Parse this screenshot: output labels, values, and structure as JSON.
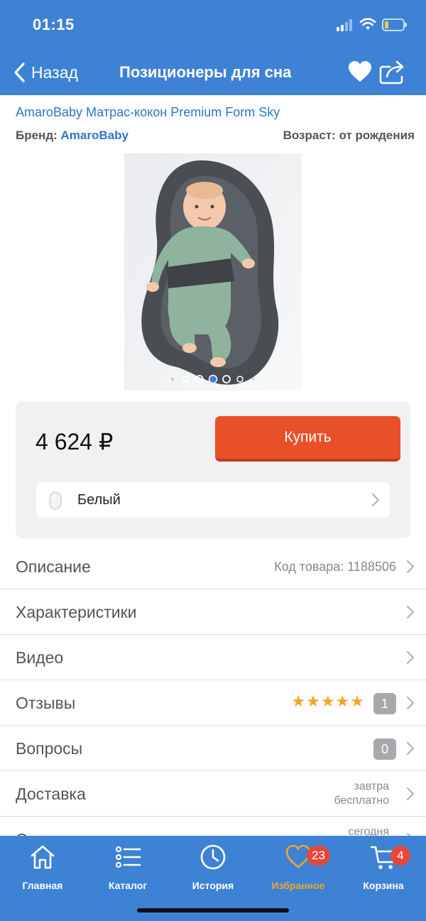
{
  "status_bar": {
    "time": "01:15"
  },
  "header": {
    "back_label": "Назад",
    "title": "Позиционеры для сна"
  },
  "product": {
    "name": "AmaroBaby Матрас-кокон Premium Form Sky",
    "brand_label": "Бренд:",
    "brand_value": "AmaroBaby",
    "age_label": "Возраст:",
    "age_value": "от рождения",
    "gallery": {
      "pages": 7,
      "active_page": 4
    }
  },
  "purchase": {
    "price": "4 624 ₽",
    "buy_label": "Купить",
    "color_label": "Белый"
  },
  "info_rows": {
    "description": {
      "label": "Описание",
      "right": "Код товара: 1188506"
    },
    "specs": {
      "label": "Характеристики"
    },
    "video": {
      "label": "Видео"
    },
    "reviews": {
      "label": "Отзывы",
      "stars": "★★★★★",
      "count": "1"
    },
    "questions": {
      "label": "Вопросы",
      "count": "0"
    },
    "delivery": {
      "label": "Доставка",
      "line1": "завтра",
      "line2": "бесплатно"
    },
    "pickup": {
      "label": "Самовывоз",
      "line1": "сегодня"
    }
  },
  "tabbar": {
    "home": "Главная",
    "catalog": "Каталог",
    "history": "История",
    "favorites": "Избранное",
    "favorites_badge": "23",
    "cart": "Корзина",
    "cart_badge": "4"
  },
  "colors": {
    "brand_blue": "#3e82d6",
    "buy_orange": "#e8502a",
    "active_tab": "#f0a52a",
    "badge_red": "#e5483a"
  }
}
